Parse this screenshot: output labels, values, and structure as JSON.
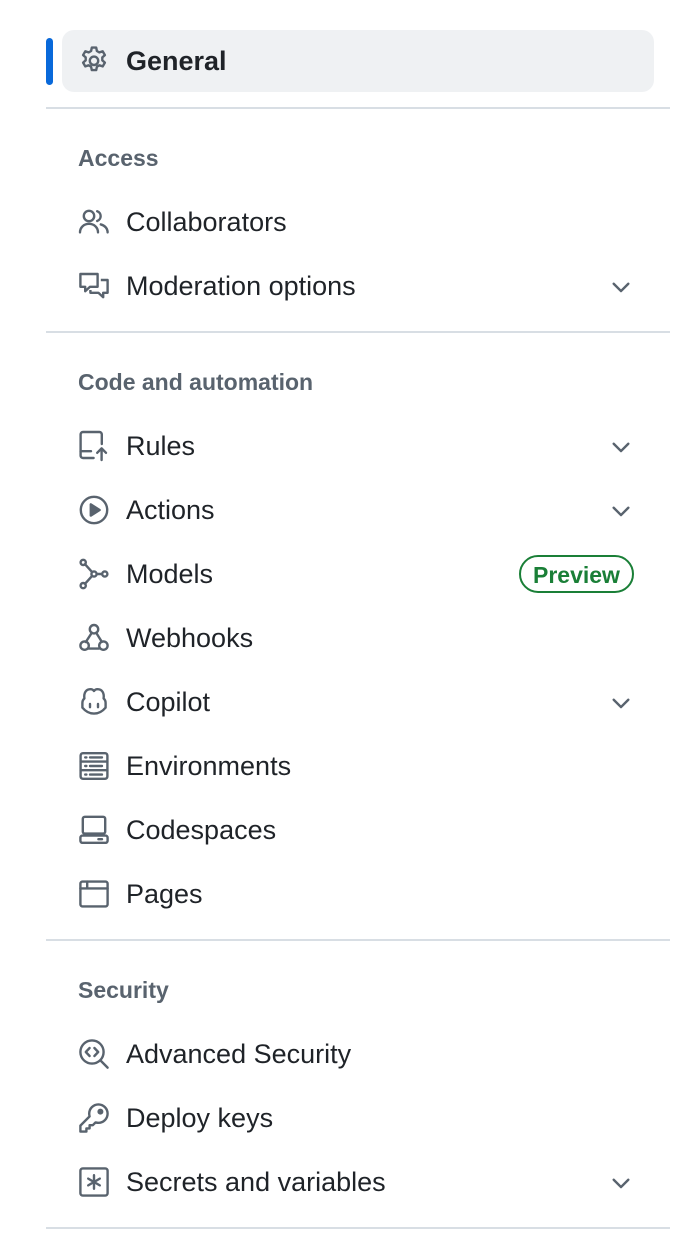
{
  "general": {
    "label": "General",
    "icon": "gear-icon"
  },
  "sections": {
    "access": {
      "heading": "Access",
      "items": [
        {
          "label": "Collaborators",
          "icon": "people-icon"
        },
        {
          "label": "Moderation options",
          "icon": "comment-discussion-icon"
        }
      ]
    },
    "code": {
      "heading": "Code and automation",
      "items": [
        {
          "label": "Rules",
          "icon": "repo-push-icon"
        },
        {
          "label": "Actions",
          "icon": "play-icon"
        },
        {
          "label": "Models",
          "icon": "ai-model-icon",
          "badge": "Preview"
        },
        {
          "label": "Webhooks",
          "icon": "webhook-icon"
        },
        {
          "label": "Copilot",
          "icon": "copilot-icon"
        },
        {
          "label": "Environments",
          "icon": "server-icon"
        },
        {
          "label": "Codespaces",
          "icon": "codespaces-icon"
        },
        {
          "label": "Pages",
          "icon": "browser-icon"
        }
      ]
    },
    "security": {
      "heading": "Security",
      "items": [
        {
          "label": "Advanced Security",
          "icon": "codescan-icon"
        },
        {
          "label": "Deploy keys",
          "icon": "key-icon"
        },
        {
          "label": "Secrets and variables",
          "icon": "key-asterisk-icon"
        }
      ]
    }
  },
  "colors": {
    "accent": "#0969da",
    "active_bg": "#eff1f3",
    "muted": "#59636e",
    "success": "#1a7f37",
    "divider": "#d8dee4"
  }
}
